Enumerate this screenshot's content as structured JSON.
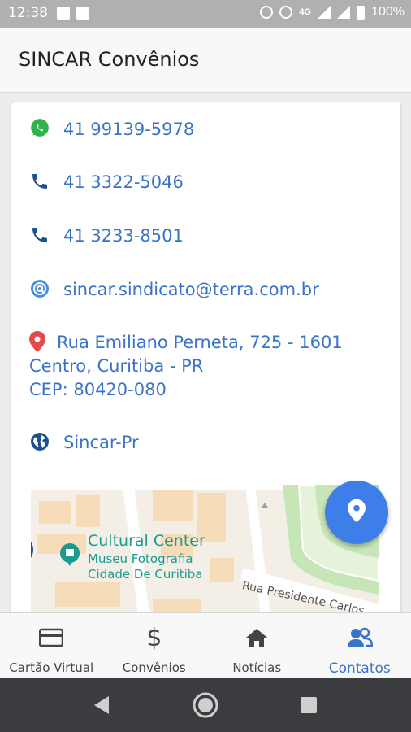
{
  "status_bar": {
    "time": "12:38",
    "network": "4G",
    "battery": "100%"
  },
  "app_bar": {
    "title": "SINCAR Convênios"
  },
  "contacts": {
    "whatsapp": {
      "icon": "whatsapp-icon",
      "text": "41 99139-5978",
      "color": "#2fb34a"
    },
    "phone1": {
      "icon": "phone-icon",
      "text": "41 3322-5046"
    },
    "phone2": {
      "icon": "phone-icon",
      "text": "41 3233-8501"
    },
    "email": {
      "icon": "at-icon",
      "text": "sincar.sindicato@terra.com.br"
    },
    "address": {
      "icon": "map-pin-icon",
      "line1": "Rua Emiliano Perneta, 725 - 1601",
      "line2": "Centro, Curitiba - PR",
      "line3": "CEP: 80420-080",
      "pin_color": "#e24b4b"
    },
    "website": {
      "icon": "globe-icon",
      "text": "Sincar-Pr"
    },
    "link_color": "#3a73c7"
  },
  "map": {
    "place_title": "Cultural Center",
    "place_sub1": "Museu Fotografia",
    "place_sub2": "Cidade De Curitiba",
    "street": "Rua Presidente Carlos",
    "teal": "#1a9b8f"
  },
  "fab": {
    "icon": "location-pin-icon",
    "color": "#3d7ee8"
  },
  "bottom_nav": {
    "items": [
      {
        "label": "Cartão Virtual",
        "icon": "credit-card-icon"
      },
      {
        "label": "Convênios",
        "icon": "dollar-icon"
      },
      {
        "label": "Notícias",
        "icon": "home-icon"
      },
      {
        "label": "Contatos",
        "icon": "contacts-icon"
      }
    ],
    "active_index": 3,
    "active_color": "#3a73c7"
  },
  "system_nav": {
    "back": "back-icon",
    "home": "home-circle-icon",
    "recents": "recents-icon"
  }
}
